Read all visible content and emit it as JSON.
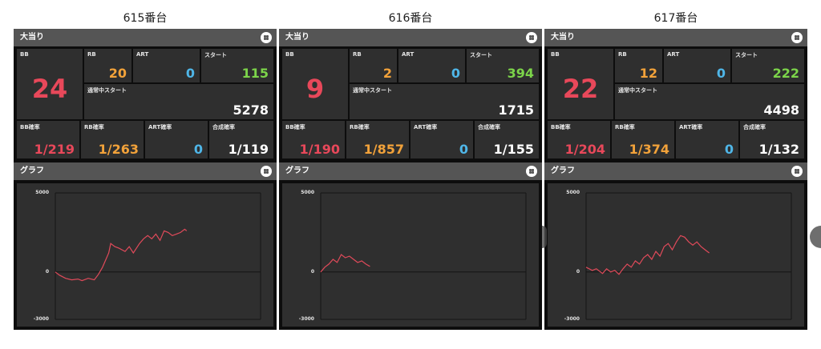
{
  "colors": {
    "bb": "#e8485a",
    "rb": "#f2a23a",
    "art": "#4fb6e8",
    "start": "#7cd44a",
    "white": "#ffffff",
    "line": "#e04a5a"
  },
  "icons": {
    "header": "grid-icon"
  },
  "machines": [
    {
      "title": "615番台",
      "header": "大当り",
      "graph_header": "グラフ",
      "labels": {
        "bb": "BB",
        "rb": "RB",
        "art": "ART",
        "start": "スタート",
        "normal_start": "通常中スタート",
        "bb_rate": "BB確率",
        "rb_rate": "RB確率",
        "art_rate": "ART確率",
        "combined_rate": "合成確率"
      },
      "values": {
        "bb": "24",
        "rb": "20",
        "art": "0",
        "start": "115",
        "normal_start": "5278",
        "bb_rate": "1/219",
        "rb_rate": "1/263",
        "art_rate": "0",
        "combined_rate": "1/119"
      },
      "graph": {
        "ymax_label": "5000",
        "zero_label": "0",
        "ymin_label": "-3000",
        "ymax": 5000,
        "ymin": -3000,
        "x_max": 100,
        "points": [
          [
            0,
            0
          ],
          [
            2,
            -200
          ],
          [
            5,
            -400
          ],
          [
            8,
            -500
          ],
          [
            11,
            -450
          ],
          [
            13,
            -550
          ],
          [
            16,
            -400
          ],
          [
            19,
            -500
          ],
          [
            21,
            -150
          ],
          [
            23,
            300
          ],
          [
            26,
            1200
          ],
          [
            27,
            1800
          ],
          [
            29,
            1600
          ],
          [
            31,
            1500
          ],
          [
            34,
            1300
          ],
          [
            36,
            1600
          ],
          [
            38,
            1200
          ],
          [
            41,
            1800
          ],
          [
            43,
            2100
          ],
          [
            45,
            2300
          ],
          [
            47,
            2100
          ],
          [
            49,
            2400
          ],
          [
            51,
            2000
          ],
          [
            53,
            2600
          ],
          [
            55,
            2500
          ],
          [
            57,
            2300
          ],
          [
            59,
            2400
          ],
          [
            61,
            2500
          ],
          [
            63,
            2700
          ],
          [
            64,
            2600
          ]
        ]
      }
    },
    {
      "title": "616番台",
      "header": "大当り",
      "graph_header": "グラフ",
      "labels": {
        "bb": "BB",
        "rb": "RB",
        "art": "ART",
        "start": "スタート",
        "normal_start": "通常中スタート",
        "bb_rate": "BB確率",
        "rb_rate": "RB確率",
        "art_rate": "ART確率",
        "combined_rate": "合成確率"
      },
      "values": {
        "bb": "9",
        "rb": "2",
        "art": "0",
        "start": "394",
        "normal_start": "1715",
        "bb_rate": "1/190",
        "rb_rate": "1/857",
        "art_rate": "0",
        "combined_rate": "1/155"
      },
      "graph": {
        "ymax_label": "5000",
        "zero_label": "0",
        "ymin_label": "-3000",
        "ymax": 5000,
        "ymin": -3000,
        "x_max": 100,
        "points": [
          [
            0,
            0
          ],
          [
            2,
            300
          ],
          [
            4,
            500
          ],
          [
            6,
            800
          ],
          [
            8,
            600
          ],
          [
            10,
            1100
          ],
          [
            12,
            900
          ],
          [
            14,
            1000
          ],
          [
            16,
            800
          ],
          [
            18,
            600
          ],
          [
            20,
            700
          ],
          [
            22,
            500
          ],
          [
            24,
            350
          ]
        ]
      }
    },
    {
      "title": "617番台",
      "header": "大当り",
      "graph_header": "グラフ",
      "labels": {
        "bb": "BB",
        "rb": "RB",
        "art": "ART",
        "start": "スタート",
        "normal_start": "通常中スタート",
        "bb_rate": "BB確率",
        "rb_rate": "RB確率",
        "art_rate": "ART確率",
        "combined_rate": "合成確率"
      },
      "values": {
        "bb": "22",
        "rb": "12",
        "art": "0",
        "start": "222",
        "normal_start": "4498",
        "bb_rate": "1/204",
        "rb_rate": "1/374",
        "art_rate": "0",
        "combined_rate": "1/132"
      },
      "graph": {
        "ymax_label": "5000",
        "zero_label": "0",
        "ymin_label": "-3000",
        "ymax": 5000,
        "ymin": -3000,
        "x_max": 100,
        "points": [
          [
            0,
            300
          ],
          [
            3,
            100
          ],
          [
            5,
            200
          ],
          [
            8,
            -100
          ],
          [
            10,
            200
          ],
          [
            12,
            0
          ],
          [
            14,
            100
          ],
          [
            16,
            -150
          ],
          [
            18,
            200
          ],
          [
            20,
            500
          ],
          [
            22,
            300
          ],
          [
            24,
            700
          ],
          [
            26,
            500
          ],
          [
            28,
            900
          ],
          [
            30,
            1100
          ],
          [
            32,
            800
          ],
          [
            34,
            1300
          ],
          [
            36,
            1000
          ],
          [
            38,
            1600
          ],
          [
            40,
            1800
          ],
          [
            42,
            1400
          ],
          [
            44,
            1900
          ],
          [
            46,
            2300
          ],
          [
            48,
            2200
          ],
          [
            50,
            1900
          ],
          [
            52,
            1700
          ],
          [
            54,
            1900
          ],
          [
            56,
            1600
          ],
          [
            58,
            1400
          ],
          [
            60,
            1200
          ]
        ]
      }
    }
  ]
}
